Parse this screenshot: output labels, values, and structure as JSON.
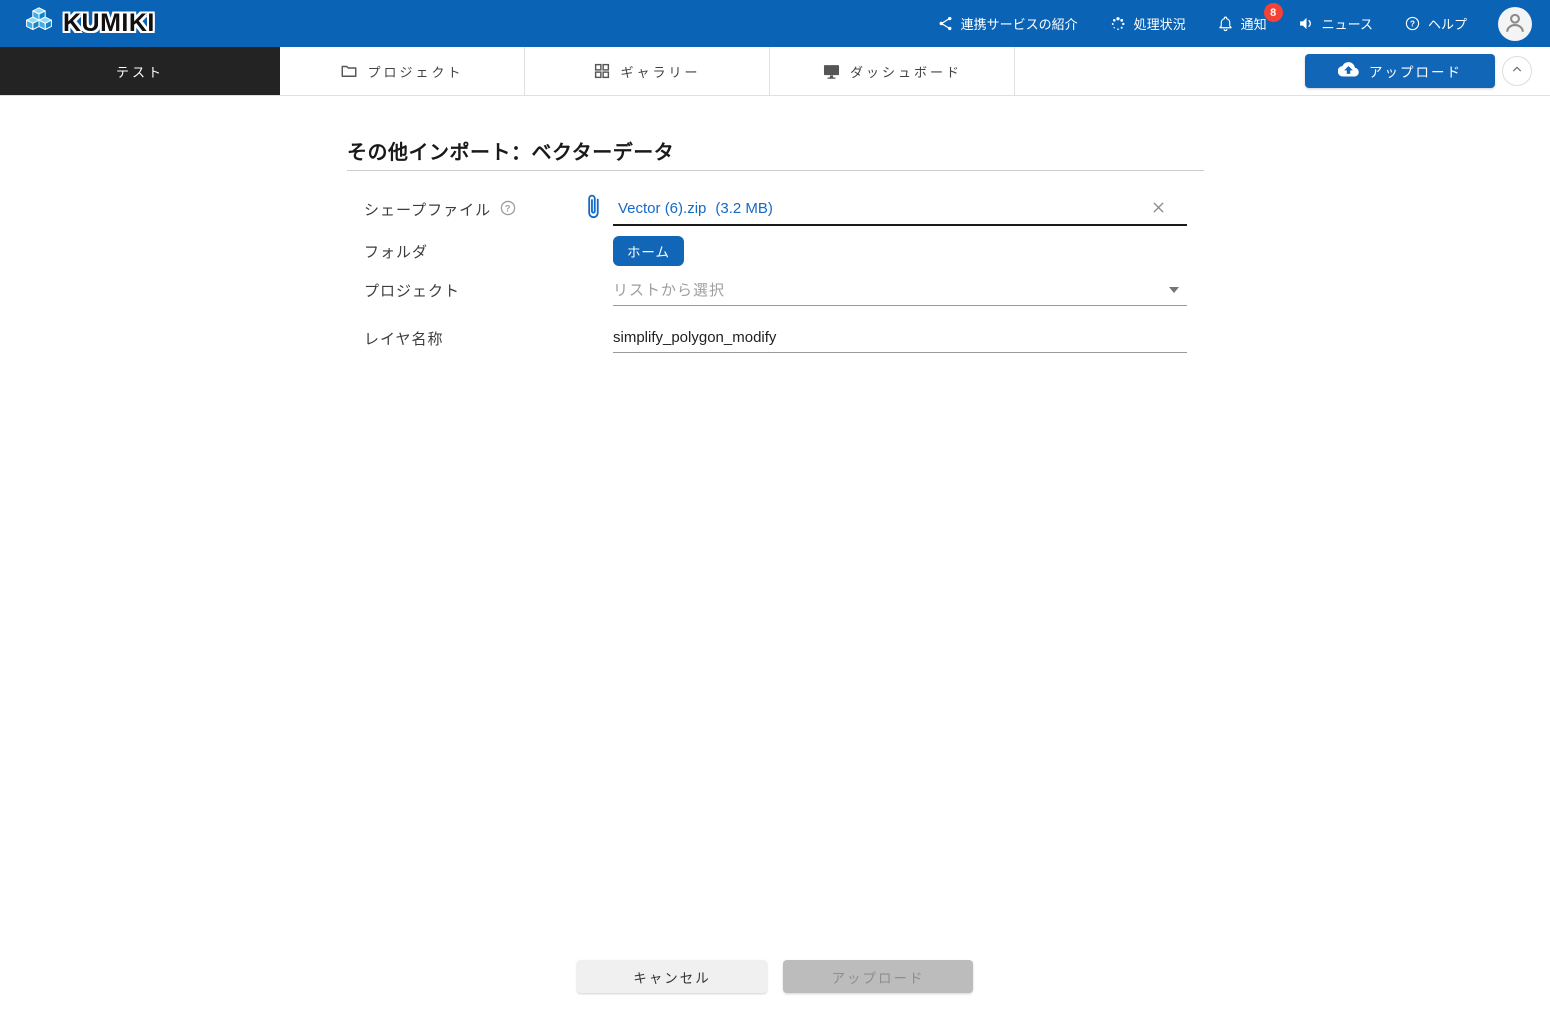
{
  "header": {
    "logo_text": "KUMIKI",
    "menu": [
      {
        "label": "連携サービスの紹介",
        "icon": "share-icon"
      },
      {
        "label": "処理状況",
        "icon": "spinner-icon"
      },
      {
        "label": "通知",
        "icon": "bell-icon",
        "badge": "8"
      },
      {
        "label": "ニュース",
        "icon": "speaker-icon"
      },
      {
        "label": "ヘルプ",
        "icon": "help-icon"
      }
    ]
  },
  "tabs": [
    {
      "label": "テスト",
      "active": true
    },
    {
      "label": "プロジェクト",
      "icon": "folder-icon"
    },
    {
      "label": "ギャラリー",
      "icon": "grid-icon"
    },
    {
      "label": "ダッシュボード",
      "icon": "monitor-icon"
    }
  ],
  "toolbar": {
    "upload_label": "アップロード"
  },
  "page": {
    "title": "その他インポート：ベクターデータ"
  },
  "form": {
    "shapefile": {
      "label": "シェープファイル",
      "file_name": "Vector (6).zip",
      "file_size": "(3.2 MB)"
    },
    "folder": {
      "label": "フォルダ",
      "selected": "ホーム"
    },
    "project": {
      "label": "プロジェクト",
      "placeholder": "リストから選択"
    },
    "layer_name": {
      "label": "レイヤ名称",
      "value": "simplify_polygon_modify"
    }
  },
  "footer": {
    "cancel_label": "キャンセル",
    "upload_label": "アップロード"
  },
  "colors": {
    "header_blue": "#0a63b5",
    "accent_blue": "#1266b8",
    "link_blue": "#1569c7",
    "badge_red": "#f44336",
    "active_tab_black": "#232323"
  }
}
